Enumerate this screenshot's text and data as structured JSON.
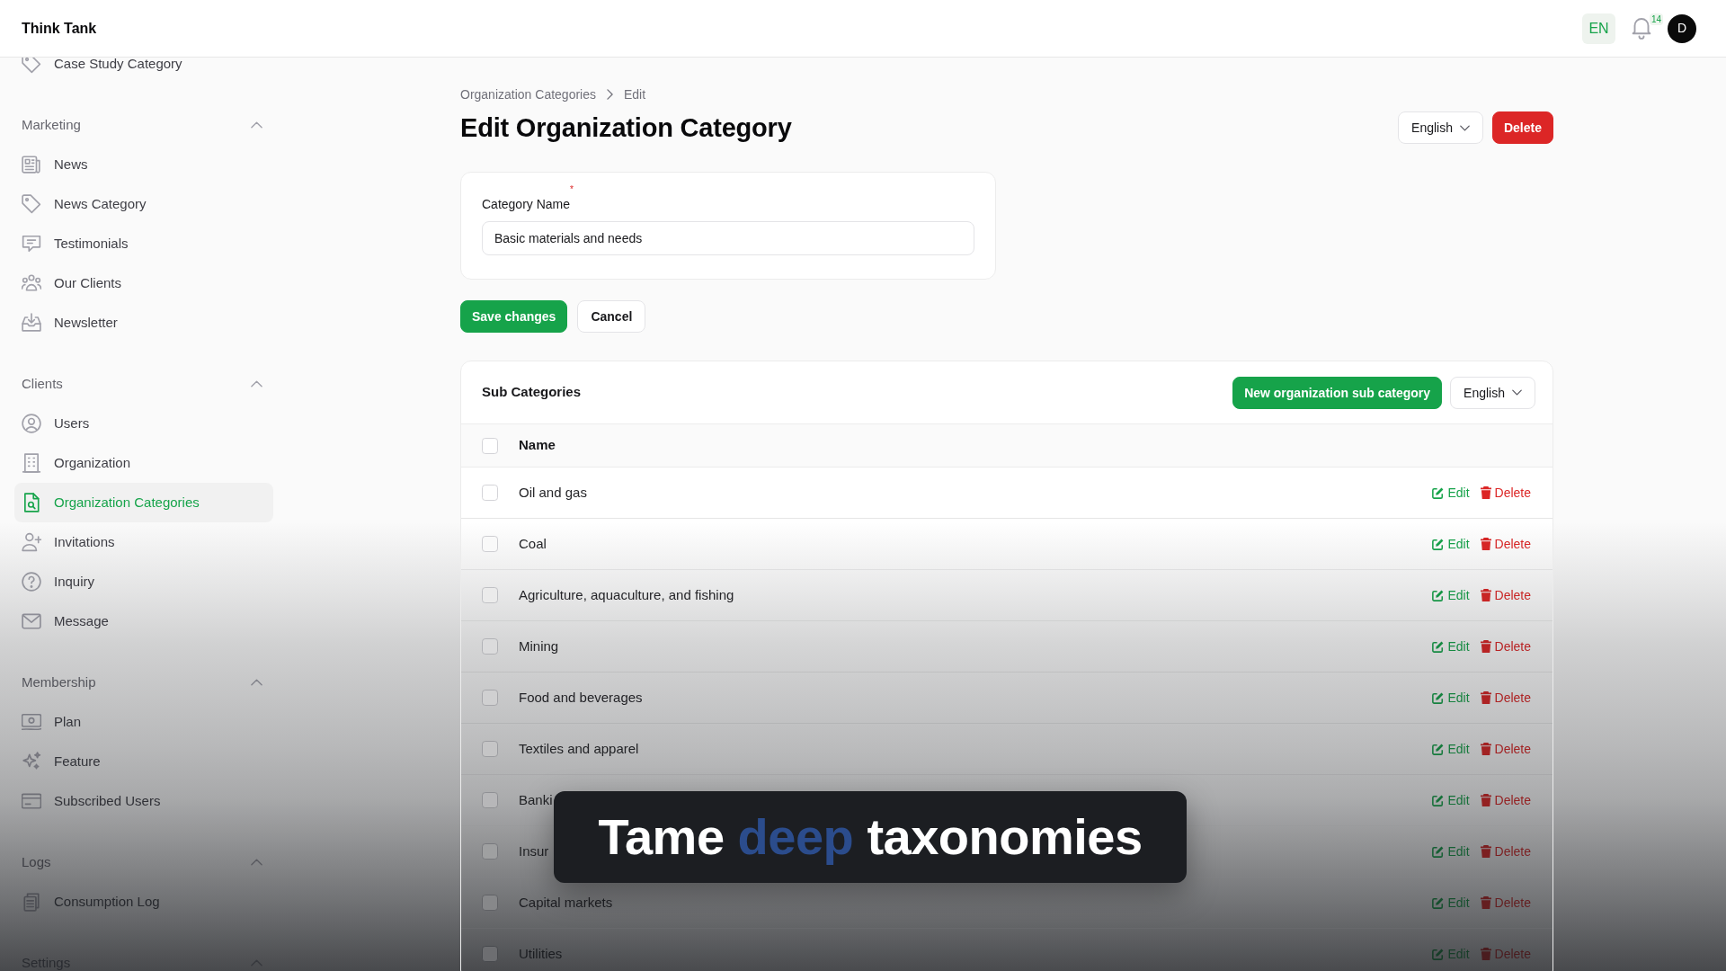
{
  "topbar": {
    "brand": "Think Tank",
    "language": "EN",
    "notification_count": "14",
    "avatar_initial": "D"
  },
  "sidebar": {
    "groups": [
      {
        "items": [
          {
            "label": "Case Study Category",
            "selected": false
          }
        ]
      },
      {
        "title": "Marketing",
        "expanded": true,
        "items": [
          {
            "label": "News",
            "selected": false
          },
          {
            "label": "News Category",
            "selected": false
          },
          {
            "label": "Testimonials",
            "selected": false
          },
          {
            "label": "Our Clients",
            "selected": false
          },
          {
            "label": "Newsletter",
            "selected": false
          }
        ]
      },
      {
        "title": "Clients",
        "expanded": true,
        "items": [
          {
            "label": "Users",
            "selected": false
          },
          {
            "label": "Organization",
            "selected": false
          },
          {
            "label": "Organization Categories",
            "selected": true
          },
          {
            "label": "Invitations",
            "selected": false
          },
          {
            "label": "Inquiry",
            "selected": false
          },
          {
            "label": "Message",
            "selected": false
          }
        ]
      },
      {
        "title": "Membership",
        "expanded": true,
        "items": [
          {
            "label": "Plan",
            "selected": false
          },
          {
            "label": "Feature",
            "selected": false
          },
          {
            "label": "Subscribed Users",
            "selected": false
          }
        ]
      },
      {
        "title": "Logs",
        "expanded": true,
        "items": [
          {
            "label": "Consumption Log",
            "selected": false
          }
        ]
      },
      {
        "title": "Settings",
        "expanded": true
      }
    ]
  },
  "breadcrumb": [
    "Organization Categories",
    "Edit"
  ],
  "page": {
    "title": "Edit Organization Category",
    "language": "English",
    "delete_label": "Delete"
  },
  "form": {
    "fields": [
      {
        "label": "Category Name",
        "required_mark": "*",
        "value": "Basic materials and needs"
      }
    ],
    "actions": [
      {
        "label": "Save changes",
        "kind": "primary"
      },
      {
        "label": "Cancel",
        "kind": "secondary"
      }
    ]
  },
  "sub_categories": {
    "title": "Sub Categories",
    "new_label": "New organization sub category",
    "language": "English",
    "table": {
      "columns": [
        "Name"
      ],
      "header_checked": false,
      "rows": [
        {
          "name": "Oil and gas",
          "checked": false,
          "edit": "Edit",
          "delete": "Delete"
        },
        {
          "name": "Coal",
          "checked": false,
          "edit": "Edit",
          "delete": "Delete"
        },
        {
          "name": "Agriculture, aquaculture, and fishing",
          "checked": false,
          "edit": "Edit",
          "delete": "Delete"
        },
        {
          "name": "Mining",
          "checked": false,
          "edit": "Edit",
          "delete": "Delete"
        },
        {
          "name": "Food and beverages",
          "checked": false,
          "edit": "Edit",
          "delete": "Delete"
        },
        {
          "name": "Textiles and apparel",
          "checked": false,
          "edit": "Edit",
          "delete": "Delete"
        },
        {
          "name": "Banki",
          "checked": false,
          "edit": "Edit",
          "delete": "Delete"
        },
        {
          "name": "Insur",
          "checked": false,
          "edit": "Edit",
          "delete": "Delete"
        },
        {
          "name": "Capital markets",
          "checked": false,
          "edit": "Edit",
          "delete": "Delete"
        },
        {
          "name": "Utilities",
          "checked": false,
          "edit": "Edit",
          "delete": "Delete"
        }
      ]
    }
  },
  "caption": {
    "parts": [
      {
        "text": "Tame",
        "highlight": false
      },
      {
        "text": "deep",
        "highlight": true
      },
      {
        "text": "taxonomies",
        "highlight": false
      }
    ]
  }
}
